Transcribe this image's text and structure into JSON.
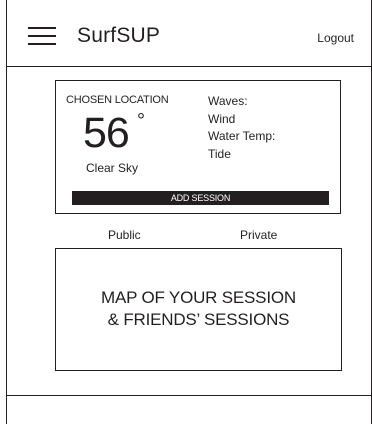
{
  "header": {
    "app_title": "SurfSUP",
    "logout_label": "Logout",
    "menu_icon": "hamburger-menu-icon"
  },
  "weather": {
    "location_label": "CHOSEN LOCATION",
    "temperature": "56",
    "degree_symbol": "°",
    "sky": "Clear Sky",
    "conditions": [
      "Waves:",
      "Wind",
      "Water Temp:",
      "Tide"
    ],
    "add_session_label": "ADD SESSION"
  },
  "tabs": [
    "Public",
    "Private"
  ],
  "map": {
    "line1": "MAP OF YOUR SESSION",
    "line2": "& FRIENDS’ SESSIONS"
  },
  "colors": {
    "ink": "#231f20",
    "background": "#ffffff"
  }
}
